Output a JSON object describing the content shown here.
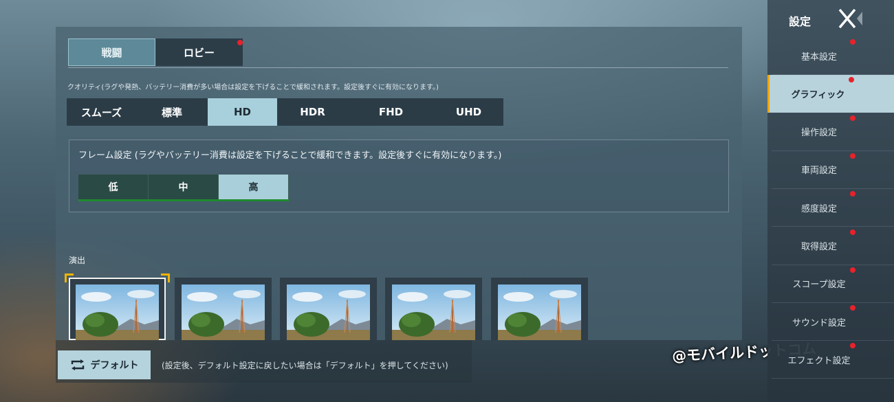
{
  "tabs": [
    {
      "label": "戦闘"
    },
    {
      "label": "ロビー"
    }
  ],
  "quality": {
    "note": "クオリティ(ラグや発熱、バッテリー消費が多い場合は設定を下げることで緩和されます。設定後すぐに有効になります。)",
    "options": [
      "スムーズ",
      "標準",
      "HD",
      "HDR",
      "FHD",
      "UHD"
    ],
    "selected": "HD"
  },
  "frame": {
    "title": "フレーム設定 (ラグやバッテリー消費は設定を下げることで緩和できます。設定後すぐに有効になります。)",
    "options": [
      "低",
      "中",
      "高"
    ],
    "selected": "高"
  },
  "effects": {
    "label": "演出",
    "selected_index": 0
  },
  "footer": {
    "default_button": "デフォルト",
    "note": "(設定後、デフォルト設定に戻したい場合は「デフォルト」を押してください)"
  },
  "watermark": "@モバイルドットコム",
  "sidebar": {
    "title": "設定",
    "items": [
      "基本設定",
      "グラフィック",
      "操作設定",
      "車両設定",
      "感度設定",
      "取得設定",
      "スコープ設定",
      "サウンド設定",
      "エフェクト設定"
    ],
    "active": "グラフィック"
  },
  "colors": {
    "accent_selected": "#a8d0dc",
    "notification_dot": "#e8222b",
    "frame_underline": "#1f8a2e",
    "selection_corner": "#f0b400"
  }
}
